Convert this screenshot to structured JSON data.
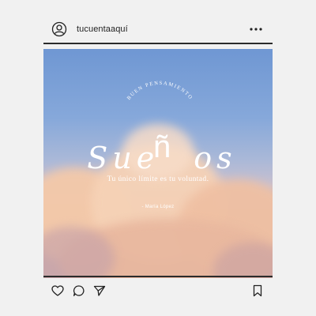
{
  "header": {
    "username": "tucuentaaquí",
    "avatar_icon": "user-circle-icon",
    "more_icon": "more-horizontal-icon"
  },
  "post": {
    "pretitle": "BUEN PENSAMIENTO",
    "title_left": "Sue",
    "title_big": "ñ",
    "title_right": "os",
    "tagline": "Tu único límite es tu voluntad.",
    "author": "- María López"
  },
  "actions": {
    "like_icon": "heart-icon",
    "comment_icon": "comment-icon",
    "share_icon": "send-icon",
    "save_icon": "bookmark-icon"
  },
  "colors": {
    "sky_top": "#6f97d3",
    "cloud": "#f3c6a8",
    "frame": "#2b2b2b",
    "background": "#f1f1f1"
  }
}
